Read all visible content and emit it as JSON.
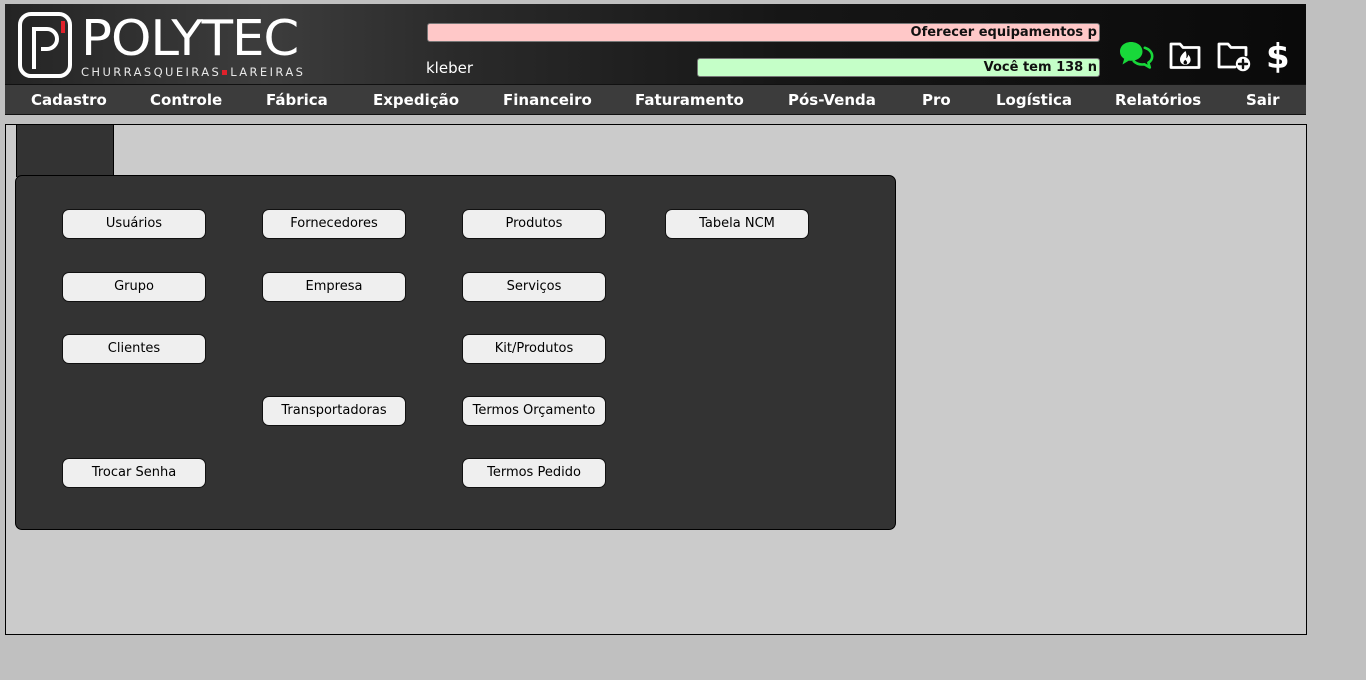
{
  "brand": {
    "title": "POLYTEC",
    "subtitle_left": "CHURRASQUEIRAS",
    "subtitle_right": "LAREIRAS",
    "accent_color": "#e0212b"
  },
  "header": {
    "user": "kleber",
    "ticker_top": "Oferecer equipamentos p",
    "ticker_bottom": "Você tem 138 n",
    "ticker_top_color": "#ffc8c8",
    "ticker_bottom_color": "#c5ffc8",
    "icons": [
      "chat-bubbles-icon",
      "folder-fire-icon",
      "folder-plus-icon",
      "dollar-icon"
    ],
    "chat_icon_color": "#18d83a",
    "dollar_glyph": "$"
  },
  "menu": {
    "items": [
      "Cadastro",
      "Controle",
      "Fábrica",
      "Expedição",
      "Financeiro",
      "Faturamento",
      "Pós-Venda",
      "Pro",
      "Logística",
      "Relatórios",
      "Sair"
    ]
  },
  "cadastro_panel": {
    "buttons": {
      "usuarios": "Usuários",
      "grupo": "Grupo",
      "clientes": "Clientes",
      "trocar_senha": "Trocar Senha",
      "fornecedores": "Fornecedores",
      "empresa": "Empresa",
      "transportadoras": "Transportadoras",
      "produtos": "Produtos",
      "servicos": "Serviços",
      "kit_produtos": "Kit/Produtos",
      "termos_orcamento": "Termos Orçamento",
      "termos_pedido": "Termos Pedido",
      "tabela_ncm": "Tabela NCM"
    }
  }
}
